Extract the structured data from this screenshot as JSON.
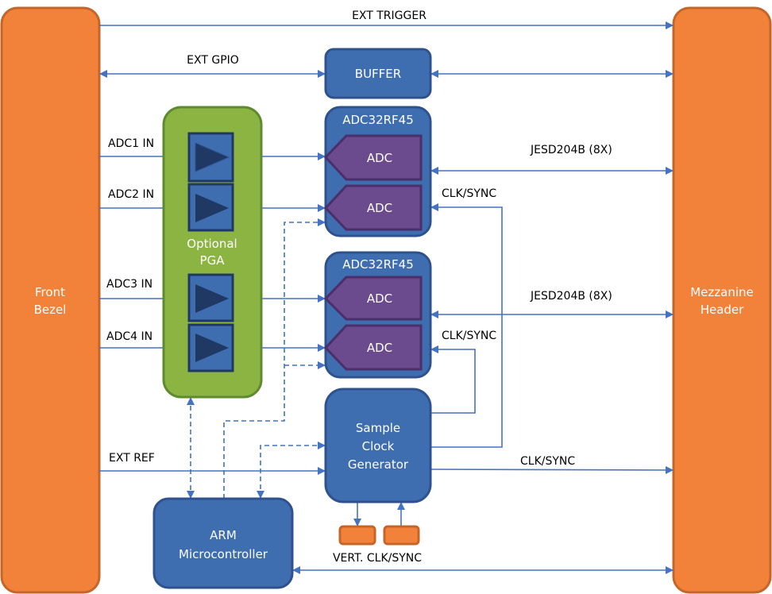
{
  "blocks": {
    "front_bezel": [
      "Front",
      "Bezel"
    ],
    "mezzanine": [
      "Mezzanine",
      "Header"
    ],
    "buffer": "BUFFER",
    "pga": [
      "Optional",
      "PGA"
    ],
    "adc_chip_1": "ADC32RF45",
    "adc_chip_2": "ADC32RF45",
    "adc": "ADC",
    "clock_gen": [
      "Sample",
      "Clock",
      "Generator"
    ],
    "arm": [
      "ARM",
      "Microcontroller"
    ]
  },
  "signals": {
    "ext_trigger": "EXT TRIGGER",
    "ext_gpio": "EXT GPIO",
    "adc1_in": "ADC1 IN",
    "adc2_in": "ADC2 IN",
    "adc3_in": "ADC3 IN",
    "adc4_in": "ADC4 IN",
    "jesd_1": "JESD204B (8X)",
    "jesd_2": "JESD204B (8X)",
    "clk_sync_1": "CLK/SYNC",
    "clk_sync_2": "CLK/SYNC",
    "clk_sync_3": "CLK/SYNC",
    "ext_ref": "EXT REF",
    "vert_clk_sync": "VERT. CLK/SYNC"
  },
  "colors": {
    "connector": "#F2823A",
    "block": "#3E6DB0",
    "pga": "#8CB443",
    "adc": "#6B4A8E",
    "line": "#4472C4"
  }
}
